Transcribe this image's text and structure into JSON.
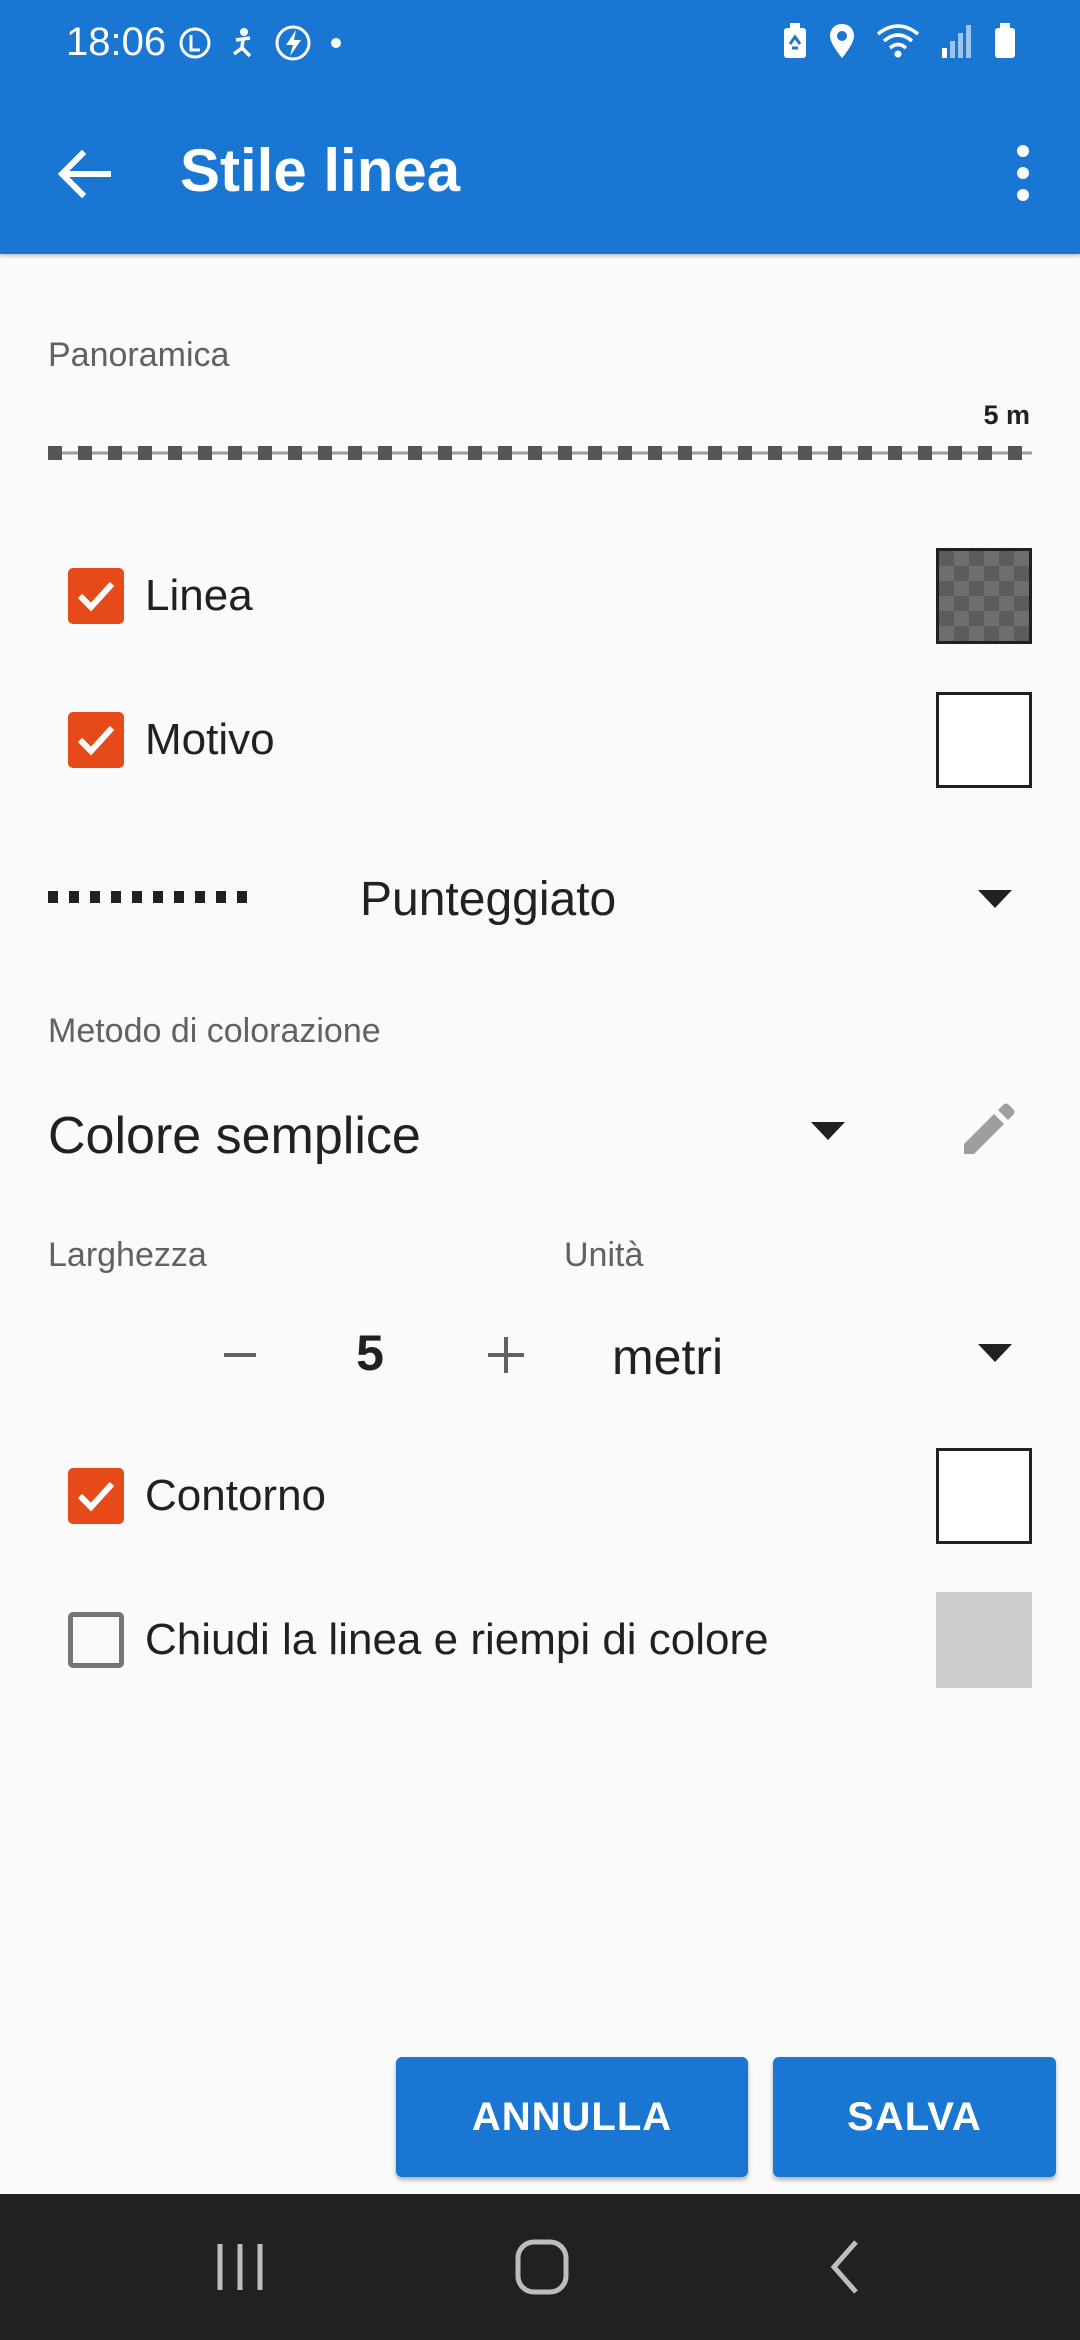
{
  "status_bar": {
    "time": "18:06",
    "left_icons": [
      "l-circle-icon",
      "accessibility-icon",
      "lightning-icon",
      "dot-icon"
    ],
    "right_icons": [
      "battery-saver-icon",
      "location-icon",
      "wifi-icon",
      "signal-icon",
      "battery-icon"
    ]
  },
  "app_bar": {
    "title": "Stile linea",
    "background": "#1976d2"
  },
  "preview": {
    "label": "Panoramica",
    "scale": "5 m"
  },
  "rows": {
    "line": {
      "label": "Linea",
      "checked": true
    },
    "pattern": {
      "label": "Motivo",
      "checked": true
    },
    "outline": {
      "label": "Contorno",
      "checked": true
    },
    "close_fill": {
      "label": "Chiudi la linea e riempi di colore",
      "checked": false
    }
  },
  "pattern_select": {
    "value": "Punteggiato"
  },
  "coloring": {
    "label": "Metodo di colorazione",
    "value": "Colore semplice"
  },
  "width": {
    "label": "Larghezza",
    "value": "5"
  },
  "unit": {
    "label": "Unità",
    "value": "metri"
  },
  "buttons": {
    "cancel": "ANNULLA",
    "save": "SALVA"
  },
  "colors": {
    "accent": "#1976d2",
    "checkbox": "#e64a19"
  }
}
